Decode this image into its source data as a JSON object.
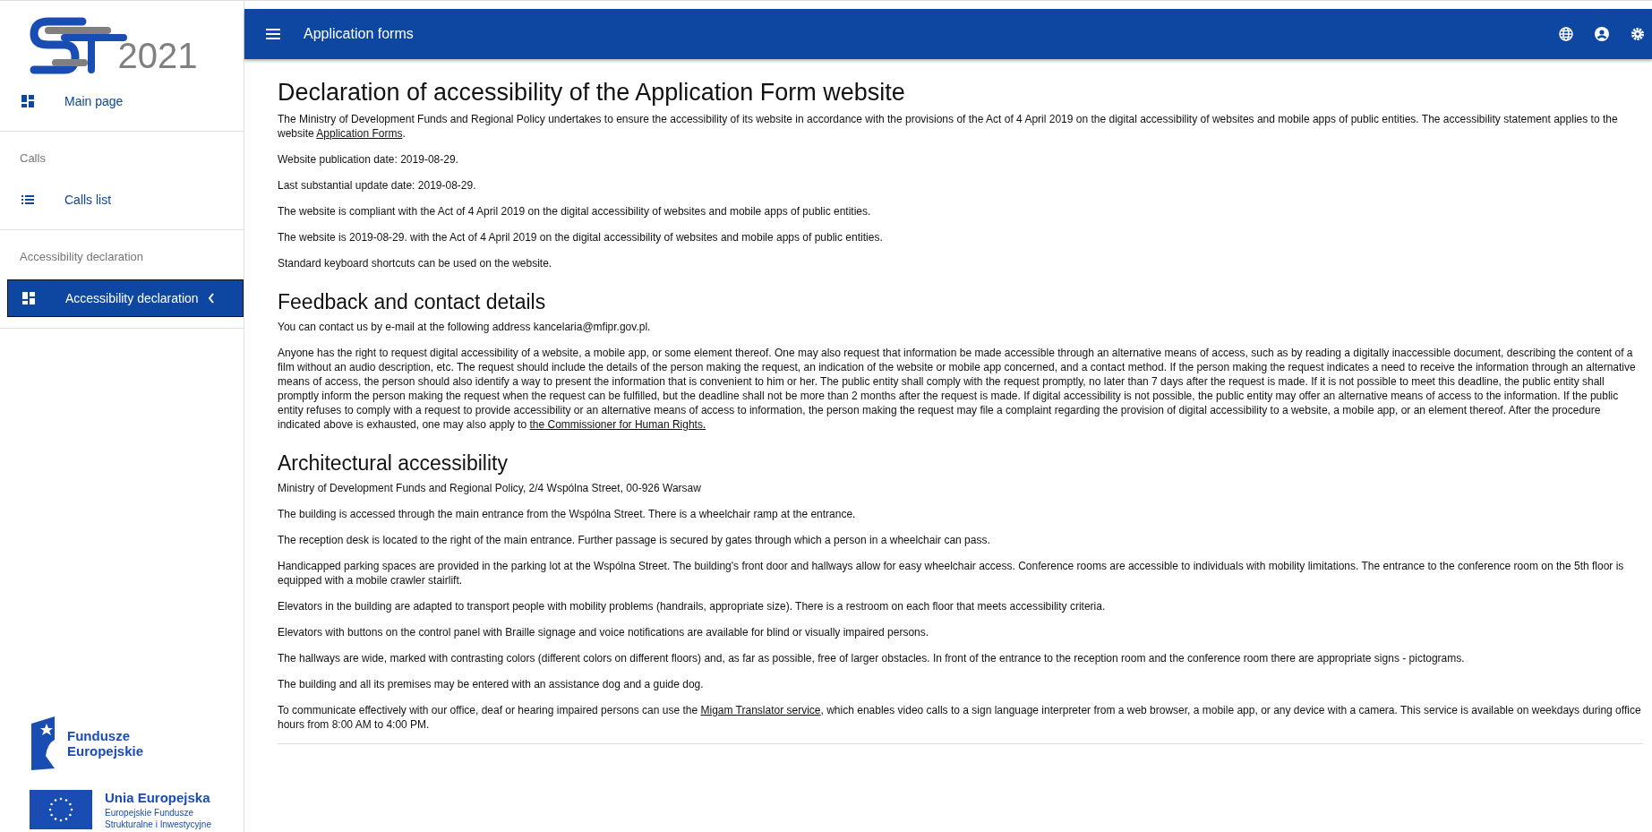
{
  "sidebar": {
    "logo": {
      "text": "2021"
    },
    "groups": [
      {
        "items": [
          {
            "label": "Main page",
            "kind": "grid",
            "selected": false
          }
        ]
      },
      {
        "heading": "Calls",
        "items": [
          {
            "label": "Calls list",
            "kind": "list",
            "selected": false
          }
        ]
      },
      {
        "heading": "Accessibility declaration",
        "items": [
          {
            "label": "Accessibility declaration",
            "kind": "grid",
            "selected": true
          }
        ]
      }
    ],
    "funds_logo": {
      "lines": [
        "Fundusze",
        "Europejskie"
      ]
    },
    "eu_logo": {
      "title": "Unia Europejska",
      "lines": [
        "Europejskie Fundusze",
        "Strukturalne i Inwestycyjne"
      ]
    }
  },
  "header": {
    "title": "Application forms"
  },
  "sections": [
    {
      "heading": "Declaration of accessibility of the Application Form website",
      "paragraphs": [
        {
          "text": "The Ministry of Development Funds and Regional Policy undertakes to ensure the accessibility of its website in accordance with the provisions of the Act of 4 April 2019 on the digital accessibility of websites and mobile apps of public entities. The accessibility statement applies to the website ",
          "link": "Application Forms",
          "after": "."
        },
        {
          "text": "Website publication date: 2019-08-29."
        },
        {
          "text": "Last substantial update date: 2019-08-29."
        },
        {
          "text": "The website is compliant with the Act of 4 April 2019 on the digital accessibility of websites and mobile apps of public entities."
        },
        {
          "text": "The website is 2019-08-29. with the Act of 4 April 2019 on the digital accessibility of websites and mobile apps of public entities."
        },
        {
          "text": "Standard keyboard shortcuts can be used on the website."
        }
      ]
    },
    {
      "heading": "Feedback and contact details",
      "paragraphs": [
        {
          "text": "You can contact us by e-mail at the following address kancelaria@mfipr.gov.pl."
        },
        {
          "text": "Anyone has the right to request digital accessibility of a website, a mobile app, or some element thereof. One may also request that information be made accessible through an alternative means of access, such as by reading a digitally inaccessible document, describing the content of a film without an audio description, etc. The request should include the details of the person making the request, an indication of the website or mobile app concerned, and a contact method. If the person making the request indicates a need to receive the information through an alternative means of access, the person should also identify a way to present the information that is convenient to him or her. The public entity shall comply with the request promptly, no later than 7 days after the request is made. If it is not possible to meet this deadline, the public entity shall promptly inform the person making the request when the request can be fulfilled, but the deadline shall not be more than 2 months after the request is made. If digital accessibility is not possible, the public entity may offer an alternative means of access to the information. If the public entity refuses to comply with a request to provide accessibility or an alternative means of access to information, the person making the request may file a complaint regarding the provision of digital accessibility to a website, a mobile app, or an element thereof. After the procedure indicated above is exhausted, one may also apply to ",
          "link": "the Commissioner for Human Rights."
        }
      ]
    },
    {
      "heading": "Architectural accessibility",
      "paragraphs": [
        {
          "text": "Ministry of Development Funds and Regional Policy, 2/4 Wspólna Street, 00-926 Warsaw"
        },
        {
          "text": "The building is accessed through the main entrance from the Wspólna Street. There is a wheelchair ramp at the entrance."
        },
        {
          "text": "The reception desk is located to the right of the main entrance. Further passage is secured by gates through which a person in a wheelchair can pass."
        },
        {
          "text": "Handicapped parking spaces are provided in the parking lot at the Wspólna Street. The building's front door and hallways allow for easy wheelchair access. Conference rooms are accessible to individuals with mobility limitations. The entrance to the conference room on the 5th floor is equipped with a mobile crawler stairlift."
        },
        {
          "text": "Elevators in the building are adapted to transport people with mobility problems (handrails, appropriate size). There is a restroom on each floor that meets accessibility criteria."
        },
        {
          "text": "Elevators with buttons on the control panel with Braille signage and voice notifications are available for blind or visually impaired persons."
        },
        {
          "text": "The hallways are wide, marked with contrasting colors (different colors on different floors) and, as far as possible, free of larger obstacles. In front of the entrance to the reception room and the conference room there are appropriate signs - pictograms."
        },
        {
          "text": "The building and all its premises may be entered with an assistance dog and a guide dog."
        },
        {
          "text": "To communicate effectively with our office, deaf or hearing impaired persons can use the ",
          "link": "Migam Translator service",
          "after": ", which enables video calls to a sign language interpreter from a web browser, a mobile app, or any device with a camera. This service is available on weekdays during office hours from 8:00 AM to 4:00 PM."
        }
      ]
    }
  ]
}
